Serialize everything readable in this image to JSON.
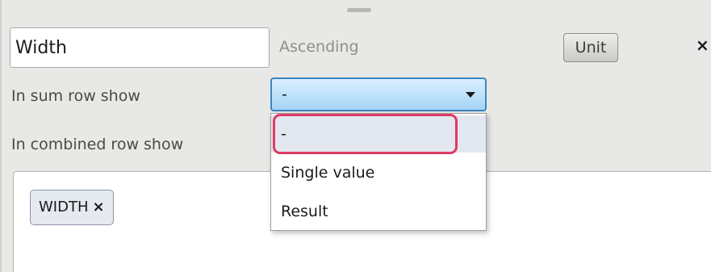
{
  "column_editor": {
    "name_value": "Width",
    "sort_label": "Ascending",
    "unit_button_label": "Unit",
    "close_symbol": "×",
    "sum_row_label": "In sum row show",
    "sum_row_select": {
      "selected": "-",
      "options": [
        "-",
        "Single value",
        "Result"
      ],
      "highlighted_option": "-"
    },
    "combined_row_label": "In combined row show",
    "values": [
      {
        "label": "WIDTH",
        "remove_symbol": "×"
      }
    ]
  },
  "colors": {
    "panel_background": "#e8e8e6",
    "select_border": "#3c86c0",
    "highlight_outline": "#de3a63",
    "chip_background": "#e5e9f0"
  },
  "icons": {
    "close": "close-icon",
    "dropdown_arrow": "chevron-down-icon",
    "tag_remove": "remove-tag-icon"
  }
}
